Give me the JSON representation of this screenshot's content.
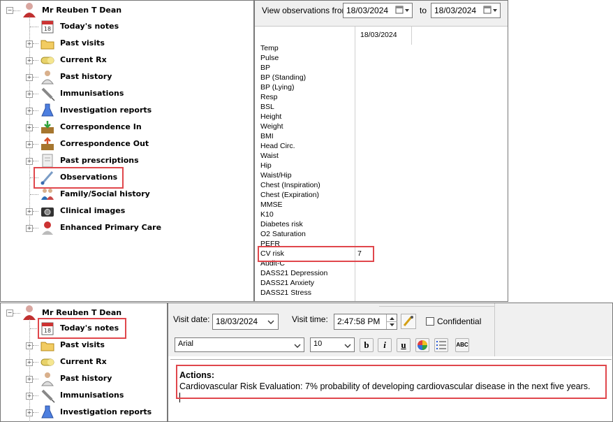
{
  "top_tree": {
    "patient": "Mr Reuben T Dean",
    "items": [
      {
        "label": "Today's notes",
        "icon": "calendar-icon",
        "expander": false
      },
      {
        "label": "Past visits",
        "icon": "folder-icon",
        "expander": true
      },
      {
        "label": "Current Rx",
        "icon": "pill-icon",
        "expander": true
      },
      {
        "label": "Past history",
        "icon": "doctor-icon",
        "expander": true
      },
      {
        "label": "Immunisations",
        "icon": "syringe-icon",
        "expander": true
      },
      {
        "label": "Investigation reports",
        "icon": "flask-icon",
        "expander": true
      },
      {
        "label": "Correspondence In",
        "icon": "inbox-icon",
        "expander": true
      },
      {
        "label": "Correspondence Out",
        "icon": "outbox-icon",
        "expander": true
      },
      {
        "label": "Past prescriptions",
        "icon": "prescription-icon",
        "expander": true
      },
      {
        "label": "Observations",
        "icon": "thermometer-icon",
        "expander": false
      },
      {
        "label": "Family/Social history",
        "icon": "family-icon",
        "expander": false
      },
      {
        "label": "Clinical images",
        "icon": "camera-icon",
        "expander": true
      },
      {
        "label": "Enhanced Primary Care",
        "icon": "epc-icon",
        "expander": true
      }
    ]
  },
  "observations": {
    "from_label": "View observations from",
    "from_date": "18/03/2024",
    "to_label": "to",
    "to_date": "18/03/2024",
    "column_header": "18/03/2024",
    "rows": [
      "Temp",
      "Pulse",
      "BP",
      "BP (Standing)",
      "BP (Lying)",
      "Resp",
      "BSL",
      "Height",
      "Weight",
      "BMI",
      "Head Circ.",
      "Waist",
      "Hip",
      "Waist/Hip",
      "Chest (Inspiration)",
      "Chest (Expiration)",
      "MMSE",
      "K10",
      "Diabetes risk",
      "O2 Saturation",
      "PEFR",
      "CV risk",
      "Audit-C",
      "DASS21 Depression",
      "DASS21 Anxiety",
      "DASS21 Stress"
    ],
    "cv_risk_value": "7"
  },
  "bottom_tree": {
    "patient": "Mr Reuben T Dean",
    "items": [
      {
        "label": "Today's notes",
        "icon": "calendar-icon",
        "expander": false
      },
      {
        "label": "Past visits",
        "icon": "folder-icon",
        "expander": true
      },
      {
        "label": "Current Rx",
        "icon": "pill-icon",
        "expander": true
      },
      {
        "label": "Past history",
        "icon": "doctor-icon",
        "expander": true
      },
      {
        "label": "Immunisations",
        "icon": "syringe-icon",
        "expander": true
      },
      {
        "label": "Investigation reports",
        "icon": "flask-icon",
        "expander": true
      }
    ]
  },
  "visit": {
    "date_label": "Visit date:",
    "date_value": "18/03/2024",
    "time_label": "Visit time:",
    "time_value": "2:47:58 PM",
    "confidential_label": "Confidential",
    "font_name": "Arial",
    "font_size": "10",
    "format_buttons": [
      "b",
      "i",
      "u",
      "color",
      "list",
      "abc"
    ]
  },
  "notes": {
    "heading": "Actions:",
    "text": "Cardiovascular Risk Evaluation: 7% probability of developing cardiovascular disease in the next five years."
  },
  "colors": {
    "highlight": "#e0474c",
    "panel_border": "#8a8a8a"
  }
}
